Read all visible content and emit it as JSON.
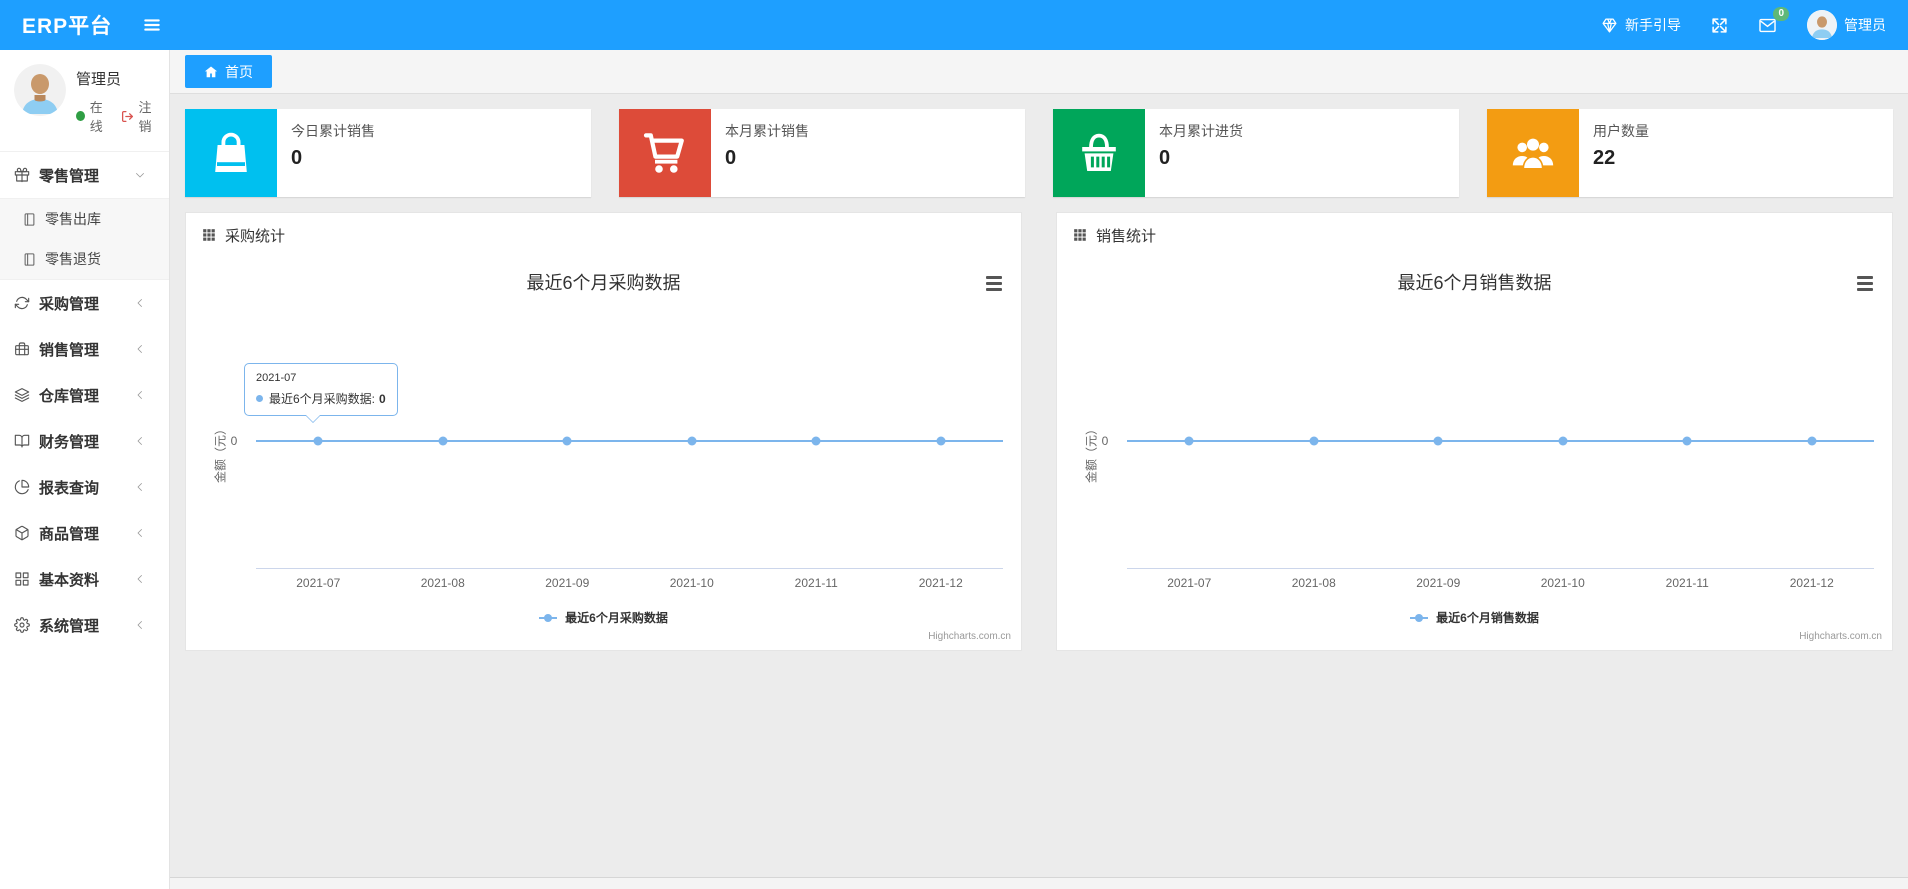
{
  "colors": {
    "primary": "#1e9fff",
    "chart_line": "#7cb5ec",
    "badge_green": "#5fb878"
  },
  "navbar": {
    "brand": "ERP平台",
    "guide": "新手引导",
    "badge": "0",
    "user": "管理员"
  },
  "sidebar": {
    "user": {
      "name": "管理员",
      "status": "在线",
      "logout": "注销"
    },
    "menu": [
      {
        "key": "retail",
        "label": "零售管理",
        "icon": "gift-icon",
        "expanded": true,
        "children": [
          {
            "key": "retail-outbound",
            "label": "零售出库",
            "icon": "document-icon"
          },
          {
            "key": "retail-return",
            "label": "零售退货",
            "icon": "document-icon"
          }
        ]
      },
      {
        "key": "purchase",
        "label": "采购管理",
        "icon": "refresh-icon"
      },
      {
        "key": "sales",
        "label": "销售管理",
        "icon": "briefcase-icon"
      },
      {
        "key": "warehouse",
        "label": "仓库管理",
        "icon": "layers-icon"
      },
      {
        "key": "finance",
        "label": "财务管理",
        "icon": "book-icon"
      },
      {
        "key": "report",
        "label": "报表查询",
        "icon": "pie-chart-icon"
      },
      {
        "key": "goods",
        "label": "商品管理",
        "icon": "package-icon"
      },
      {
        "key": "basic",
        "label": "基本资料",
        "icon": "grid-icon"
      },
      {
        "key": "system",
        "label": "系统管理",
        "icon": "gear-icon"
      }
    ]
  },
  "tabbar": {
    "active_tab": "首页"
  },
  "stat_cards": [
    {
      "key": "today-sales",
      "label": "今日累计销售",
      "value": "0",
      "color": "#00c0ef",
      "icon": "shopping-bag-icon"
    },
    {
      "key": "month-sales",
      "label": "本月累计销售",
      "value": "0",
      "color": "#dd4b39",
      "icon": "shopping-cart-icon"
    },
    {
      "key": "month-purchase",
      "label": "本月累计进货",
      "value": "0",
      "color": "#00a65a",
      "icon": "shopping-basket-icon"
    },
    {
      "key": "user-count",
      "label": "用户数量",
      "value": "22",
      "color": "#f39c12",
      "icon": "users-icon"
    }
  ],
  "panels": [
    {
      "title": "采购统计"
    },
    {
      "title": "销售统计"
    }
  ],
  "chart_data": [
    {
      "type": "line",
      "title": "最近6个月采购数据",
      "categories": [
        "2021-07",
        "2021-08",
        "2021-09",
        "2021-10",
        "2021-11",
        "2021-12"
      ],
      "series": [
        {
          "name": "最近6个月采购数据",
          "values": [
            0,
            0,
            0,
            0,
            0,
            0
          ]
        }
      ],
      "ylabel": "金额（元）",
      "yticks": [
        "0"
      ],
      "ylim": [
        0,
        1
      ],
      "grid": false,
      "legend_position": "bottom",
      "line_color": "#7cb5ec",
      "credit": "Highcharts.com.cn",
      "tooltip": {
        "header": "2021-07",
        "label": "最近6个月采购数据:",
        "value": "0"
      }
    },
    {
      "type": "line",
      "title": "最近6个月销售数据",
      "categories": [
        "2021-07",
        "2021-08",
        "2021-09",
        "2021-10",
        "2021-11",
        "2021-12"
      ],
      "series": [
        {
          "name": "最近6个月销售数据",
          "values": [
            0,
            0,
            0,
            0,
            0,
            0
          ]
        }
      ],
      "ylabel": "金额（元）",
      "yticks": [
        "0"
      ],
      "ylim": [
        0,
        1
      ],
      "grid": false,
      "legend_position": "bottom",
      "line_color": "#7cb5ec",
      "credit": "Highcharts.com.cn"
    }
  ]
}
